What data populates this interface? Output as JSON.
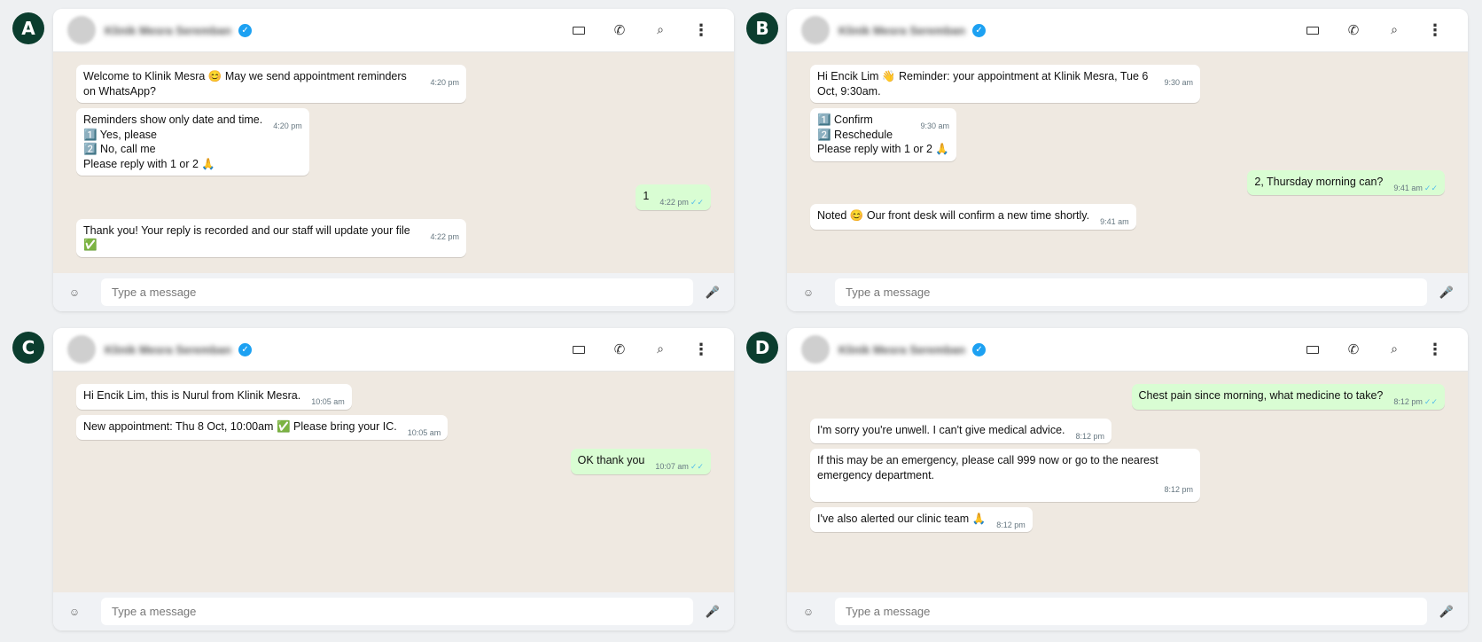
{
  "placeholder": "Type a message",
  "contact_name": "Klinik Mesra Seremban",
  "panels": [
    {
      "letter": "A",
      "messages": [
        {
          "dir": "in",
          "text": "Welcome to Klinik Mesra 😊 May we send appointment reminders on WhatsApp?",
          "time": "4:20 pm"
        },
        {
          "dir": "in",
          "text": "Reminders show only date and time.\n1️⃣ Yes, please\n2️⃣ No, call me\nPlease reply with 1 or 2 🙏",
          "time": "4:20 pm"
        },
        {
          "dir": "out",
          "text": "1",
          "time": "4:22 pm",
          "gap": true
        },
        {
          "dir": "in",
          "text": "Thank you! Your reply is recorded and our staff will update your file ✅",
          "time": "4:22 pm",
          "gap": true
        }
      ]
    },
    {
      "letter": "B",
      "messages": [
        {
          "dir": "in",
          "text": "Hi Encik Lim 👋 Reminder: your appointment at Klinik Mesra, Tue 6 Oct, 9:30am.",
          "time": "9:30 am"
        },
        {
          "dir": "in",
          "text": "1️⃣ Confirm\n2️⃣ Reschedule\nPlease reply with 1 or 2 🙏",
          "time": "9:30 am"
        },
        {
          "dir": "out",
          "text": "2, Thursday morning can?",
          "time": "9:41 am",
          "gap": true
        },
        {
          "dir": "in",
          "text": "Noted 😊 Our front desk will confirm a new time shortly.",
          "time": "9:41 am",
          "gap": true
        }
      ]
    },
    {
      "letter": "C",
      "messages": [
        {
          "dir": "in",
          "text": "Hi Encik Lim, this is Nurul from Klinik Mesra.",
          "time": "10:05 am"
        },
        {
          "dir": "in",
          "text": "New appointment: Thu 8 Oct, 10:00am ✅ Please bring your IC.",
          "time": "10:05 am"
        },
        {
          "dir": "out",
          "text": "OK thank you",
          "time": "10:07 am",
          "gap": true
        }
      ]
    },
    {
      "letter": "D",
      "messages": [
        {
          "dir": "out",
          "text": "Chest pain since morning, what medicine to take?",
          "time": "8:12 pm"
        },
        {
          "dir": "in",
          "text": "I'm sorry you're unwell. I can't give medical advice.",
          "time": "8:12 pm",
          "gap": true
        },
        {
          "dir": "in",
          "text": "If this may be an emergency, please call 999 now or go to the nearest emergency department.",
          "time": "8:12 pm",
          "block_time": true
        },
        {
          "dir": "in",
          "text": "I've also alerted our clinic team 🙏",
          "time": "8:12 pm"
        }
      ]
    }
  ],
  "colors": {
    "badge": "#0b3d2e",
    "chat_bg": "#efe9e1",
    "outgoing_bubble": "#d9fdd3",
    "incoming_bubble": "#ffffff",
    "read_ticks": "#53bdeb",
    "verified": "#1da1f2"
  },
  "icons": [
    "verified-icon",
    "video-call-icon",
    "phone-call-icon",
    "search-icon",
    "more-options-icon",
    "emoji-icon",
    "microphone-icon"
  ]
}
